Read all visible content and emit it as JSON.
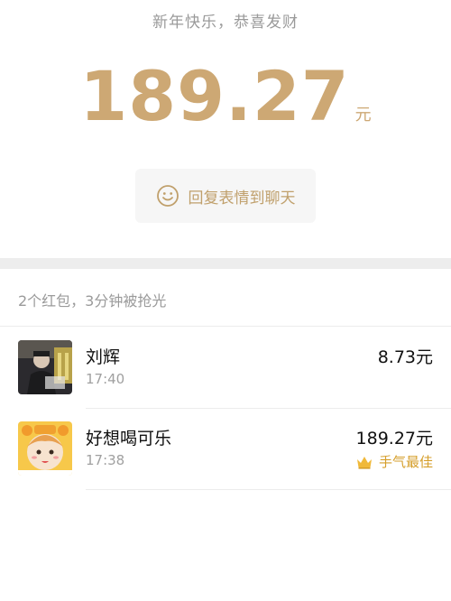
{
  "header": {
    "greeting": "新年快乐，恭喜发财",
    "amount": "189.27",
    "unit": "元"
  },
  "reply_button": {
    "icon": "smiley-icon",
    "label": "回复表情到聊天"
  },
  "summary": "2个红包，3分钟被抢光",
  "records": [
    {
      "name": "刘辉",
      "time": "17:40",
      "amount": "8.73元",
      "badge": ""
    },
    {
      "name": "好想喝可乐",
      "time": "17:38",
      "amount": "189.27元",
      "badge": "手气最佳"
    }
  ],
  "colors": {
    "gold": "#cda874",
    "badge": "#d59e2a"
  }
}
